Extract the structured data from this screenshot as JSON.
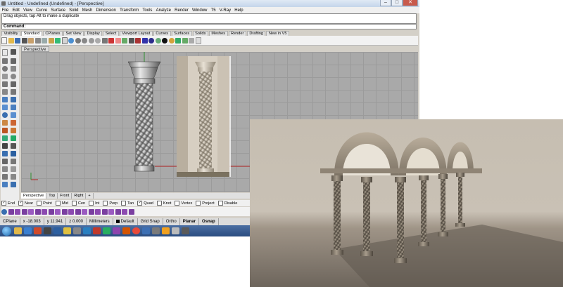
{
  "window": {
    "title": "Untitled - Undefined (Undefined) - [Perspective]",
    "minimize": "–",
    "maximize": "□",
    "close": "✕"
  },
  "menu": [
    "File",
    "Edit",
    "View",
    "Curve",
    "Surface",
    "Solid",
    "Mesh",
    "Dimension",
    "Transform",
    "Tools",
    "Analyze",
    "Render",
    "Window",
    "T5",
    "V-Ray",
    "Help"
  ],
  "command": {
    "history_line": "Drag objects, tap Alt to make a duplicate",
    "prompt": "Command:"
  },
  "toolbar_tabs": [
    "Visibility",
    "Standard",
    "CPlanes",
    "Set View",
    "Display",
    "Select",
    "Viewport Layout",
    "Curves",
    "Surfaces",
    "Solids",
    "Meshes",
    "Render",
    "Drafting",
    "New in V5"
  ],
  "active_toolbar_tab": "Standard",
  "viewport": {
    "title": "Perspective"
  },
  "viewport_tabs": [
    "Perspective",
    "Top",
    "Front",
    "Right",
    "+"
  ],
  "osnaps": [
    {
      "label": "End",
      "checked": true
    },
    {
      "label": "Near",
      "checked": true
    },
    {
      "label": "Point",
      "checked": false
    },
    {
      "label": "Mid",
      "checked": false
    },
    {
      "label": "Cen",
      "checked": false
    },
    {
      "label": "Int",
      "checked": false
    },
    {
      "label": "Perp",
      "checked": false
    },
    {
      "label": "Tan",
      "checked": false
    },
    {
      "label": "Quad",
      "checked": true
    },
    {
      "label": "Knot",
      "checked": false
    },
    {
      "label": "Vertex",
      "checked": false
    },
    {
      "label": "Project",
      "checked": false
    },
    {
      "label": "Disable",
      "checked": false
    }
  ],
  "status": {
    "cplane": "CPlane",
    "x": "x -18.003",
    "y": "y 11.941",
    "z": "z 0.000",
    "units": "Millimeters",
    "layer": "Default",
    "grid_snap": "Grid Snap",
    "ortho": "Ortho",
    "planar": "Planar",
    "osnap": "Osnap"
  },
  "icons": {
    "app": "rhino-icon",
    "start": "windows-start-orb"
  },
  "colors": {
    "viewport_bg": "#a9a9a9",
    "grid_line": "#9b9b9b",
    "axis_red": "#b02020",
    "axis_green": "#2f8f2f",
    "taskbar": "#2a4c80"
  }
}
